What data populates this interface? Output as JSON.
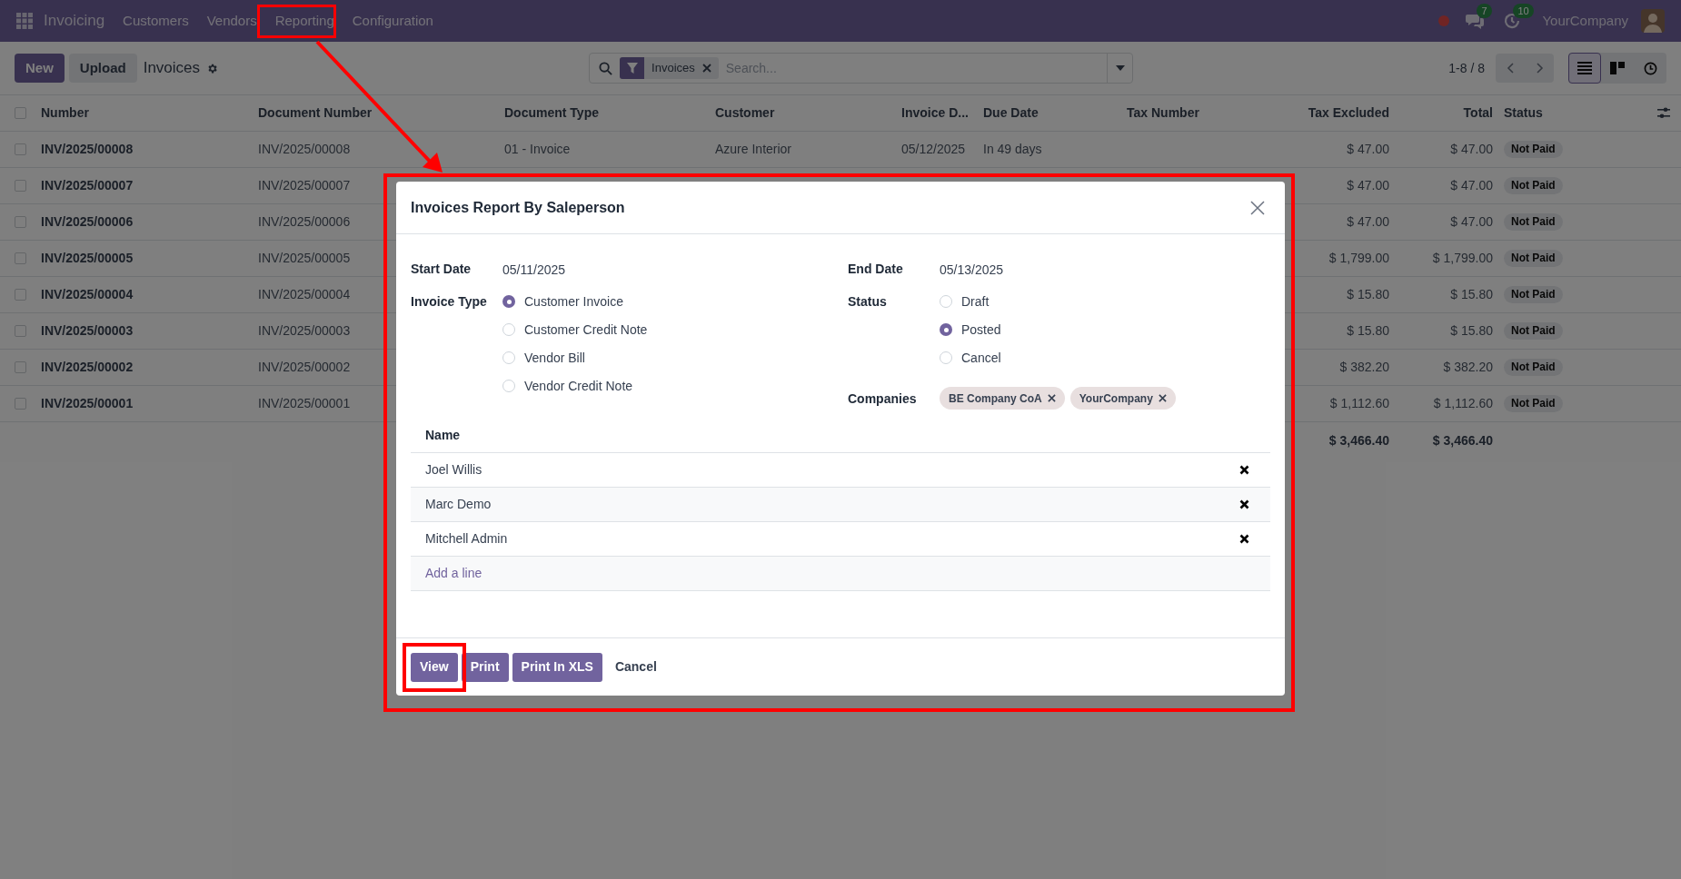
{
  "navbar": {
    "app_name": "Invoicing",
    "menu": [
      "Customers",
      "Vendors",
      "Reporting",
      "Configuration"
    ],
    "messages_badge": "7",
    "activities_badge": "10",
    "company": "YourCompany"
  },
  "control_panel": {
    "buttons": [
      {
        "label": "New",
        "kind": "primary"
      },
      {
        "label": "Upload",
        "kind": "secondary"
      }
    ],
    "title": "Invoices",
    "search": {
      "facet": "Invoices",
      "placeholder": "Search..."
    },
    "pager": "1-8 / 8",
    "views": [
      {
        "kind": "list",
        "selected": true
      },
      {
        "kind": "kanban",
        "selected": false
      },
      {
        "kind": "activity",
        "selected": false
      }
    ]
  },
  "table": {
    "all_checked": false,
    "columns": [
      "Number",
      "Document Number",
      "Document Type",
      "Customer",
      "Invoice D...",
      "Due Date",
      "Tax Number",
      "Tax Excluded",
      "Total",
      "Status"
    ],
    "rows": [
      {
        "checked": false,
        "number": "INV/2025/00008",
        "document_number": "INV/2025/00008",
        "document_type": "01 - Invoice",
        "customer": "Azure Interior",
        "invoice_date": "05/12/2025",
        "due_date": "In 49 days",
        "tax_excluded": "$ 47.00",
        "total": "$ 47.00",
        "status": "Not Paid"
      },
      {
        "checked": false,
        "number": "INV/2025/00007",
        "document_number": "INV/2025/00007",
        "tax_excluded": "$ 47.00",
        "total": "$ 47.00",
        "status": "Not Paid"
      },
      {
        "checked": false,
        "number": "INV/2025/00006",
        "document_number": "INV/2025/00006",
        "tax_excluded": "$ 47.00",
        "total": "$ 47.00",
        "status": "Not Paid"
      },
      {
        "checked": false,
        "number": "INV/2025/00005",
        "document_number": "INV/2025/00005",
        "tax_excluded": "$ 1,799.00",
        "total": "$ 1,799.00",
        "status": "Not Paid"
      },
      {
        "checked": false,
        "number": "INV/2025/00004",
        "document_number": "INV/2025/00004",
        "tax_excluded": "$ 15.80",
        "total": "$ 15.80",
        "status": "Not Paid"
      },
      {
        "checked": false,
        "number": "INV/2025/00003",
        "document_number": "INV/2025/00003",
        "tax_excluded": "$ 15.80",
        "total": "$ 15.80",
        "status": "Not Paid"
      },
      {
        "checked": false,
        "number": "INV/2025/00002",
        "document_number": "INV/2025/00002",
        "tax_excluded": "$ 382.20",
        "total": "$ 382.20",
        "status": "Not Paid"
      },
      {
        "checked": false,
        "number": "INV/2025/00001",
        "document_number": "INV/2025/00001",
        "tax_excluded": "$ 1,112.60",
        "total": "$ 1,112.60",
        "status": "Not Paid"
      }
    ],
    "totals": {
      "tax_excluded": "$ 3,466.40",
      "total": "$ 3,466.40"
    }
  },
  "dialog": {
    "title": "Invoices Report By Saleperson",
    "start_date": {
      "label": "Start Date",
      "value": "05/11/2025"
    },
    "end_date": {
      "label": "End Date",
      "value": "05/13/2025"
    },
    "invoice_type": {
      "label": "Invoice Type",
      "options": [
        {
          "label": "Customer Invoice",
          "selected": true
        },
        {
          "label": "Customer Credit Note",
          "selected": false
        },
        {
          "label": "Vendor Bill",
          "selected": false
        },
        {
          "label": "Vendor Credit Note",
          "selected": false
        }
      ]
    },
    "status": {
      "label": "Status",
      "options": [
        {
          "label": "Draft",
          "selected": false
        },
        {
          "label": "Posted",
          "selected": true
        },
        {
          "label": "Cancel",
          "selected": false
        }
      ]
    },
    "companies": {
      "label": "Companies",
      "tags": [
        "BE Company CoA",
        "YourCompany"
      ]
    },
    "lines": {
      "header": "Name",
      "rows": [
        "Joel Willis",
        "Marc Demo",
        "Mitchell Admin"
      ],
      "add_line": "Add a line"
    },
    "buttons": [
      {
        "label": "View",
        "kind": "primary"
      },
      {
        "label": "Print",
        "kind": "primary"
      },
      {
        "label": "Print In XLS",
        "kind": "primary"
      },
      {
        "label": "Cancel",
        "kind": "link"
      }
    ]
  }
}
